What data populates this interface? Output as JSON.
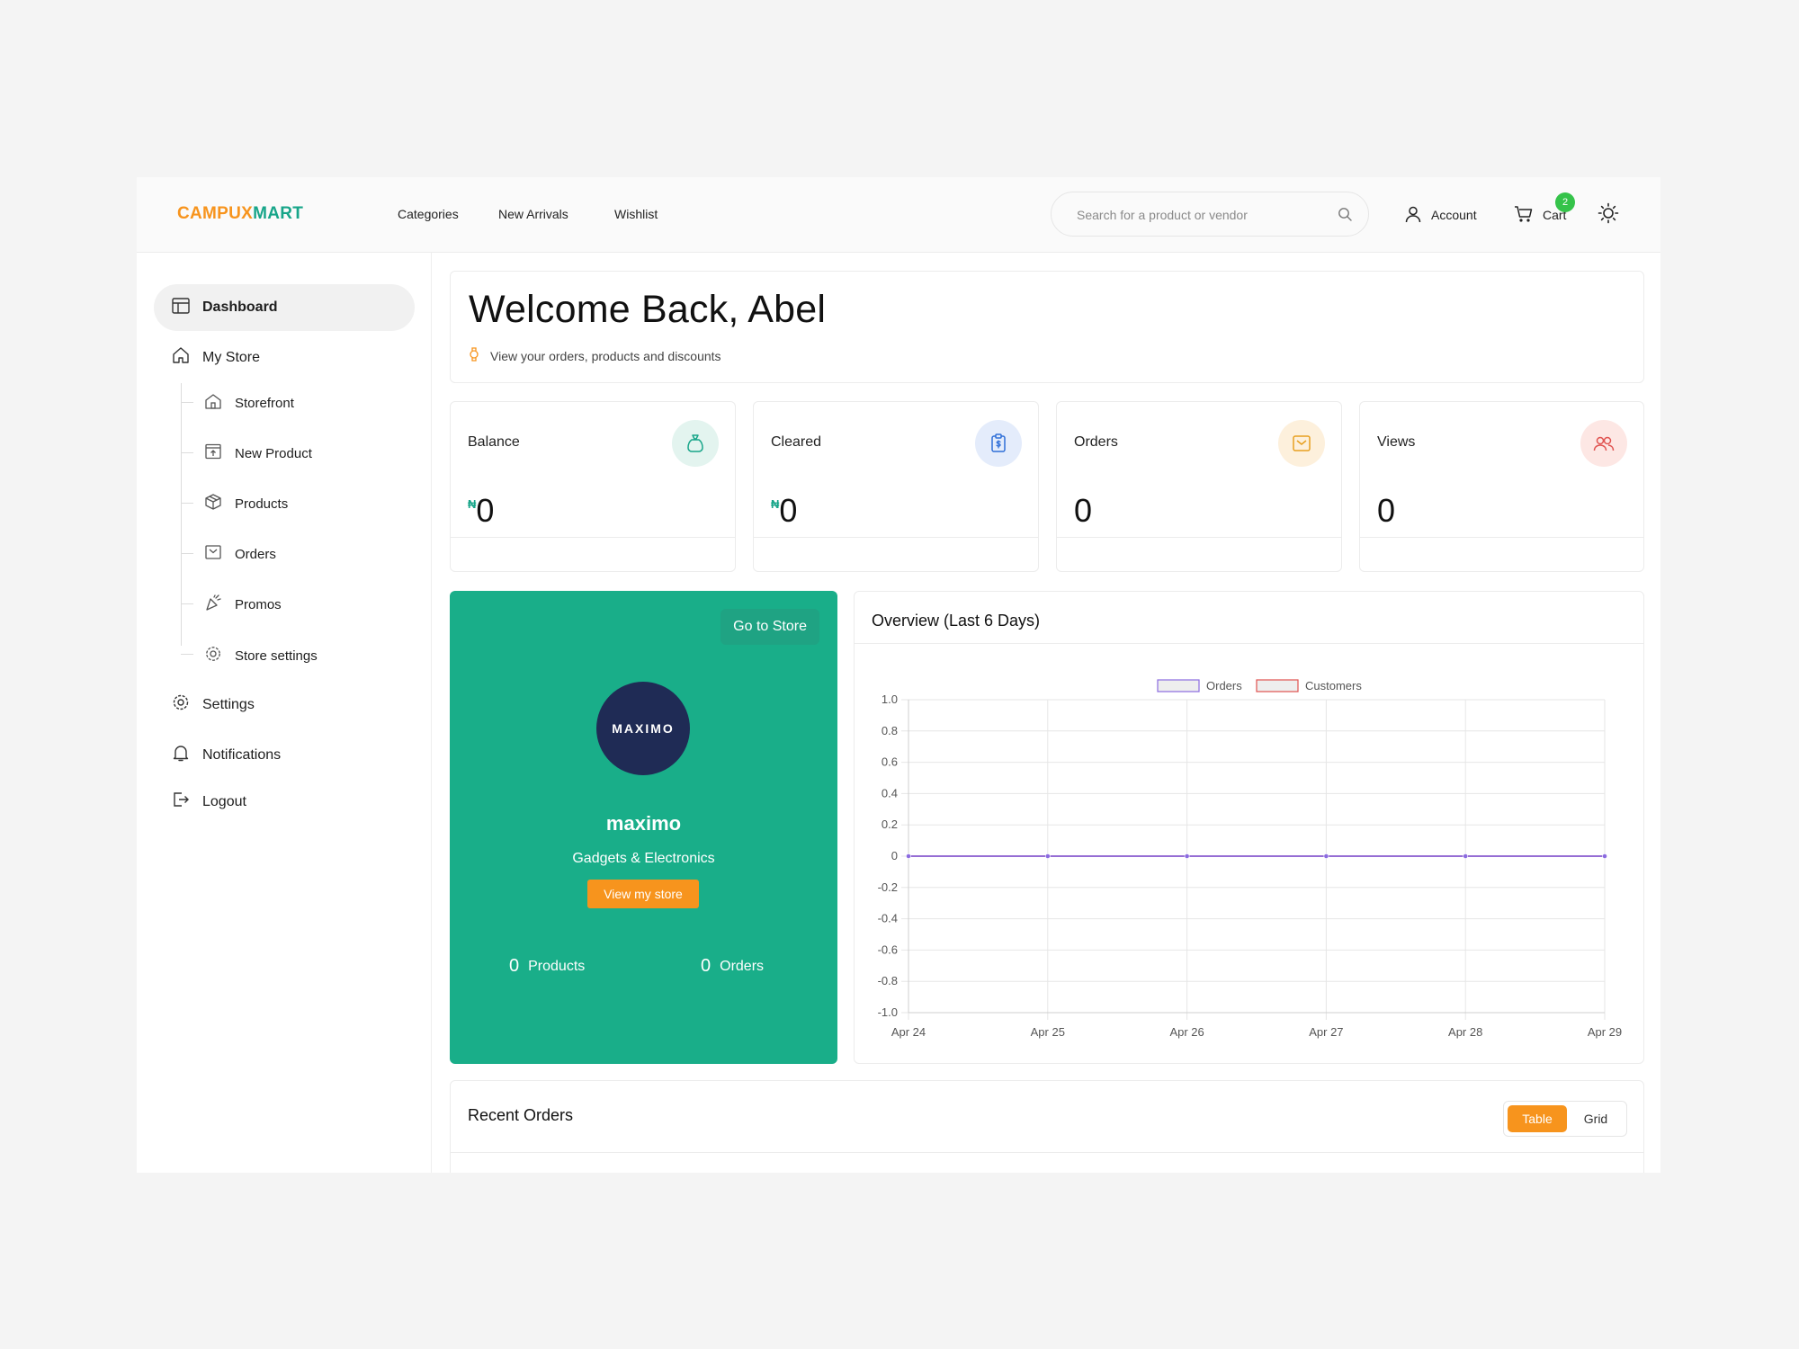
{
  "brand": {
    "part1": "CAMPUX",
    "part2": "MART"
  },
  "nav": {
    "categories": "Categories",
    "new_arrivals": "New Arrivals",
    "wishlist": "Wishlist"
  },
  "search": {
    "placeholder": "Search for a product or vendor"
  },
  "header": {
    "account": "Account",
    "cart": "Cart",
    "cart_count": "2"
  },
  "sidebar": {
    "dashboard": "Dashboard",
    "my_store": "My Store",
    "storefront": "Storefront",
    "new_product": "New Product",
    "products": "Products",
    "orders": "Orders",
    "promos": "Promos",
    "store_settings": "Store settings",
    "settings": "Settings",
    "notifications": "Notifications",
    "logout": "Logout"
  },
  "welcome": {
    "title": "Welcome Back, Abel",
    "subtitle": "View your orders, products and discounts"
  },
  "stats": [
    {
      "label": "Balance",
      "currency": "₦",
      "value": "0",
      "color": "#17a589",
      "bg": "#e3f4ef"
    },
    {
      "label": "Cleared",
      "currency": "₦",
      "value": "0",
      "color": "#2f6fd8",
      "bg": "#e4ecfb"
    },
    {
      "label": "Orders",
      "currency": "",
      "value": "0",
      "color": "#e8a020",
      "bg": "#fdf0dc"
    },
    {
      "label": "Views",
      "currency": "",
      "value": "0",
      "color": "#e0524f",
      "bg": "#fde7e4"
    }
  ],
  "store": {
    "goto": "Go to Store",
    "logo_text": "MAXIMO",
    "name": "maximo",
    "category": "Gadgets & Electronics",
    "view_button": "View my store",
    "products_count": "0",
    "products_label": "Products",
    "orders_count": "0",
    "orders_label": "Orders"
  },
  "overview": {
    "title": "Overview (Last 6 Days)"
  },
  "chart_data": {
    "type": "line",
    "x": [
      "Apr 24",
      "Apr 25",
      "Apr 26",
      "Apr 27",
      "Apr 28",
      "Apr 29"
    ],
    "series": [
      {
        "name": "Orders",
        "values": [
          0,
          0,
          0,
          0,
          0,
          0
        ],
        "color": "#8b6be0"
      },
      {
        "name": "Customers",
        "values": [
          0,
          0,
          0,
          0,
          0,
          0
        ],
        "color": "#e0524f"
      }
    ],
    "ylim": [
      -1.0,
      1.0
    ],
    "yticks": [
      "1.0",
      "0.8",
      "0.6",
      "0.4",
      "0.2",
      "0",
      "-0.2",
      "-0.4",
      "-0.6",
      "-0.8",
      "-1.0"
    ],
    "grid": true,
    "legend": "top-center"
  },
  "recent": {
    "title": "Recent Orders",
    "table_label": "Table",
    "grid_label": "Grid"
  },
  "colors": {
    "brand_orange": "#f7941d",
    "brand_green": "#19ae89",
    "accent_dark": "#1f2b55"
  }
}
